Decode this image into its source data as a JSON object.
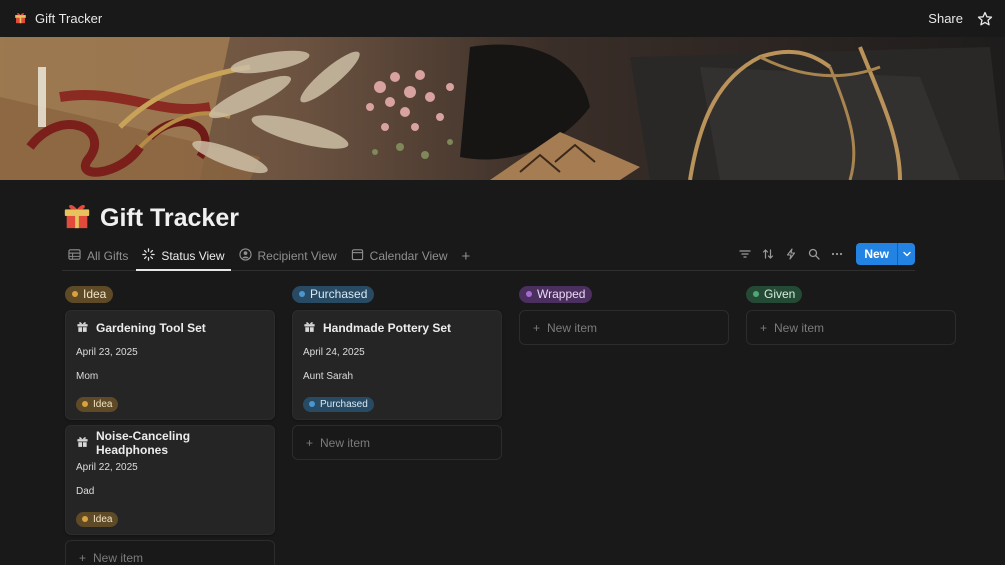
{
  "topbar": {
    "title": "Gift Tracker",
    "share_label": "Share",
    "page_icon": "gift-icon",
    "star_icon": "star-icon"
  },
  "page": {
    "title": "Gift Tracker",
    "icon": "gift-icon"
  },
  "views": [
    {
      "label": "All Gifts",
      "icon": "table-icon",
      "active": false
    },
    {
      "label": "Status View",
      "icon": "loading-icon",
      "active": true
    },
    {
      "label": "Recipient View",
      "icon": "person-icon",
      "active": false
    },
    {
      "label": "Calendar View",
      "icon": "calendar-icon",
      "active": false
    }
  ],
  "toolbar": {
    "new_label": "New",
    "icons": [
      "filter-icon",
      "sort-icon",
      "automation-icon",
      "search-icon",
      "more-icon",
      "chevron-down-icon"
    ]
  },
  "colors": {
    "accent": "#2383e2",
    "background": "#191919",
    "card": "#252525"
  },
  "board": {
    "new_item_label": "New item",
    "columns": [
      {
        "status": "Idea",
        "cards": [
          {
            "title": "Gardening Tool Set",
            "date": "April 23, 2025",
            "recipient": "Mom",
            "status": "Idea"
          },
          {
            "title": "Noise-Canceling Headphones",
            "date": "April 22, 2025",
            "recipient": "Dad",
            "status": "Idea"
          }
        ]
      },
      {
        "status": "Purchased",
        "cards": [
          {
            "title": "Handmade Pottery Set",
            "date": "April 24, 2025",
            "recipient": "Aunt Sarah",
            "status": "Purchased"
          }
        ]
      },
      {
        "status": "Wrapped",
        "cards": []
      },
      {
        "status": "Given",
        "cards": []
      }
    ]
  }
}
